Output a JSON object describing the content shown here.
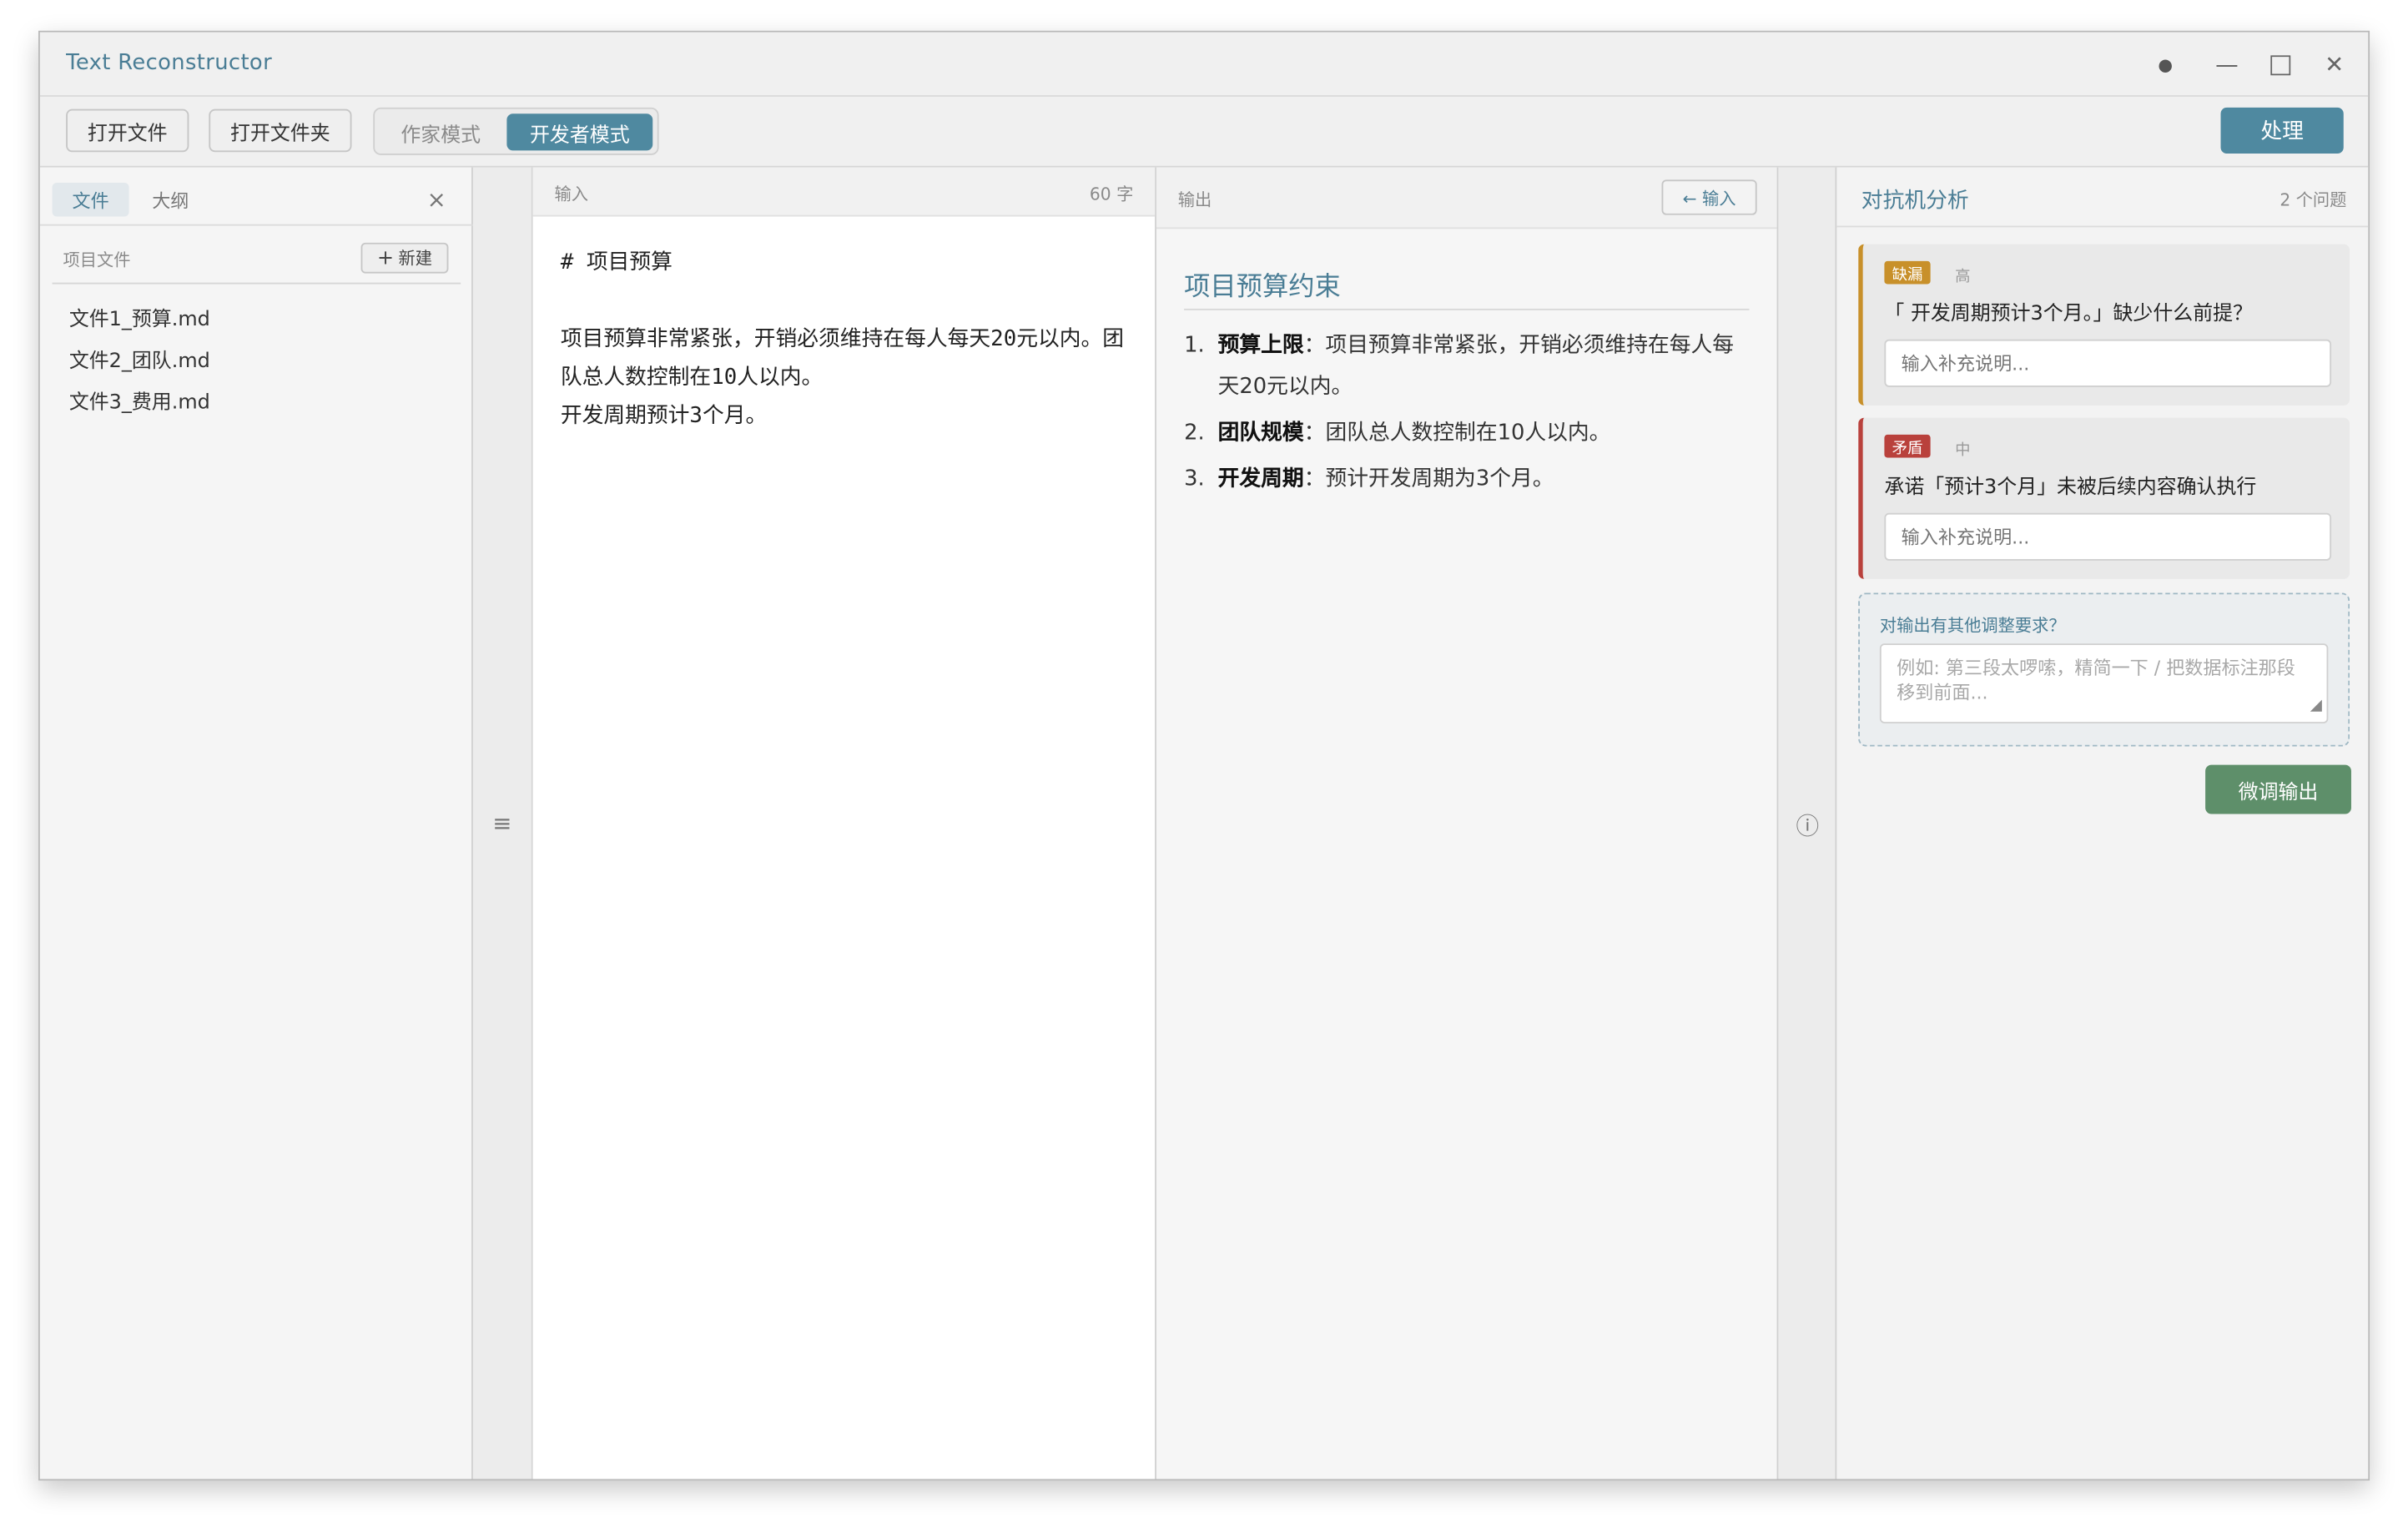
{
  "app": {
    "title": "Text Reconstructor"
  },
  "window_controls": {
    "theme_icon": "●",
    "minimize_icon": "—",
    "maximize_icon": "□",
    "close_icon": "✕"
  },
  "toolbar": {
    "open_file": "打开文件",
    "open_folder": "打开文件夹",
    "modes": [
      {
        "label": "作家模式",
        "active": false
      },
      {
        "label": "开发者模式",
        "active": true
      }
    ],
    "process": "处理"
  },
  "sidebar": {
    "tabs": [
      {
        "label": "文件",
        "active": true
      },
      {
        "label": "大纲",
        "active": false
      }
    ],
    "close_icon": "×",
    "section_label": "项目文件",
    "new_icon": "+",
    "new_button": "新建",
    "files": [
      "文件1_预算.md",
      "文件2_团队.md",
      "文件3_费用.md"
    ]
  },
  "gutters": {
    "left_icon": "≡",
    "right_icon": "ⓘ"
  },
  "input_panel": {
    "label": "输入",
    "count": "60 字",
    "text": "# 项目预算\n\n项目预算非常紧张，开销必须维持在每人每天20元以内。团队总人数控制在10人以内。\n开发周期预计3个月。"
  },
  "output_panel": {
    "label": "输出",
    "back_button": "← 输入",
    "heading": "项目预算约束",
    "items": [
      {
        "num": "1.",
        "title": "预算上限",
        "sep": "：",
        "text": "项目预算非常紧张，开销必须维持在每人每天20元以内。"
      },
      {
        "num": "2.",
        "title": "团队规模",
        "sep": "：",
        "text": "团队总人数控制在10人以内。"
      },
      {
        "num": "3.",
        "title": "开发周期",
        "sep": "：",
        "text": "预计开发周期为3个月。"
      }
    ]
  },
  "analysis": {
    "title": "对抗机分析",
    "count": "2 个问题",
    "issues": [
      {
        "tag": "缺漏",
        "severity": "高",
        "question": "「 开发周期预计3个月。」缺少什么前提？",
        "placeholder": "输入补充说明...",
        "color": "#c8902a"
      },
      {
        "tag": "矛盾",
        "severity": "中",
        "question": "承诺「预计3个月」未被后续内容确认执行",
        "placeholder": "输入补充说明...",
        "color": "#b9413c"
      }
    ],
    "adjust_label": "对输出有其他调整要求？",
    "adjust_placeholder": "例如: 第三段太啰嗦，精简一下 / 把数据标注那段移到前面...",
    "finetune_button": "微调输出"
  },
  "colors": {
    "accent": "#4f89a0",
    "accent_text": "#4a7d95",
    "green": "#5e8f6a"
  }
}
